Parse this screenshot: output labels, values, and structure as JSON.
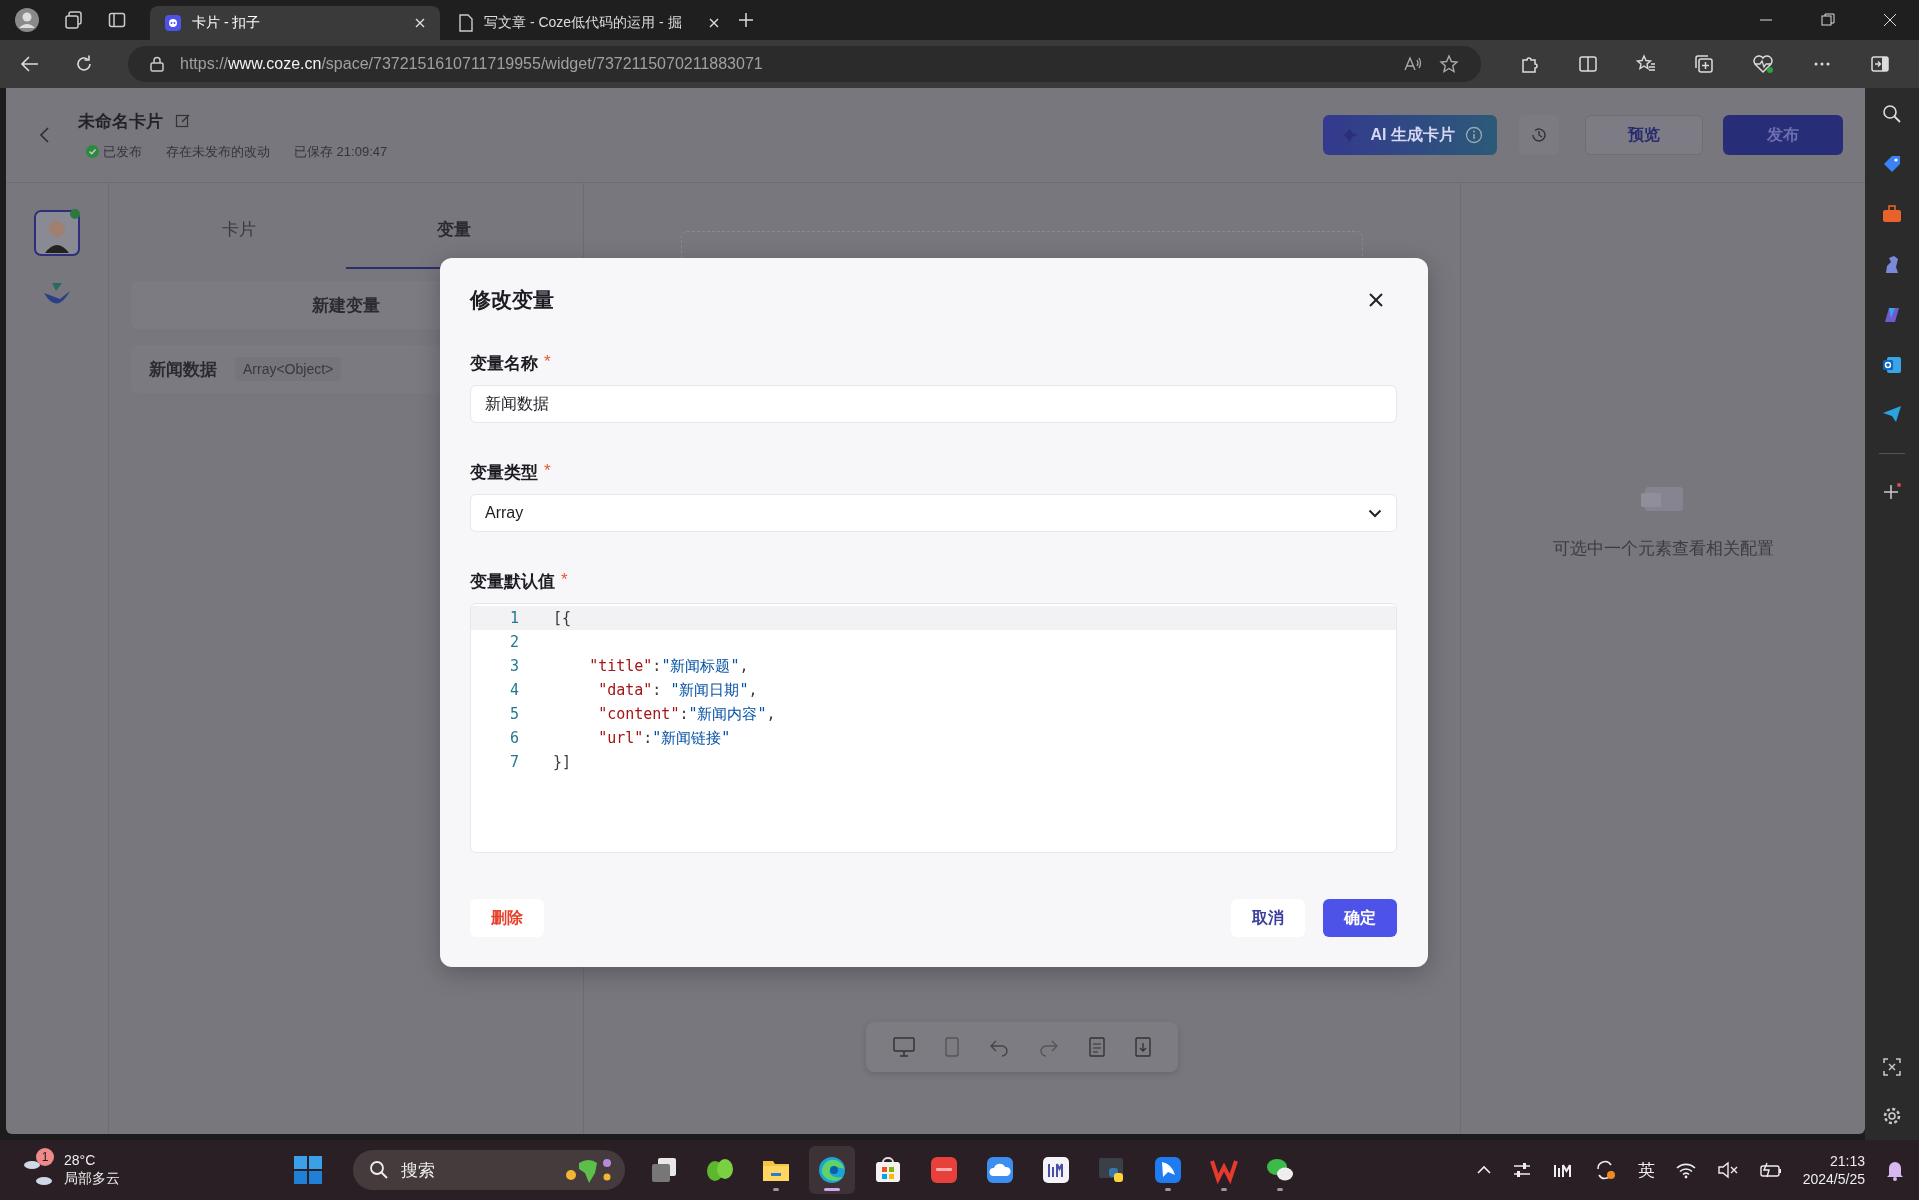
{
  "browser": {
    "tabs": [
      {
        "title": "卡片 - 扣子",
        "selected": true,
        "kind": "coze"
      },
      {
        "title": "写文章 - Coze低代码的运用 - 掘",
        "selected": false,
        "kind": "doc"
      }
    ],
    "url": "https://**www.coze.cn**/space/7372151610711719955/widget/7372115070211883071"
  },
  "header": {
    "title": "未命名卡片",
    "status": "已发布",
    "changes": "存在未发布的改动",
    "saved": "已保存 21:09:47",
    "ai_button": "AI 生成卡片",
    "preview_button": "预览",
    "publish_button": "发布"
  },
  "left_panel": {
    "tabs": [
      {
        "label": "卡片",
        "selected": false
      },
      {
        "label": "变量",
        "selected": true
      }
    ],
    "new_variable_button": "新建变量",
    "variables": [
      {
        "name": "新闻数据",
        "type": "Array<Object>"
      }
    ]
  },
  "right_panel": {
    "hint": "可选中一个元素查看相关配置"
  },
  "modal": {
    "title": "修改变量",
    "name_field": {
      "label": "变量名称",
      "required_mark": "*",
      "value": "新闻数据"
    },
    "type_field": {
      "label": "变量类型",
      "required_mark": "*",
      "value": "Array"
    },
    "default_field": {
      "label": "变量默认值",
      "required_mark": "*",
      "lines": [
        {
          "number": "1",
          "text": "[{"
        },
        {
          "number": "2"
        },
        {
          "number": "3",
          "text": "    \"title\":\"新闻标题\","
        },
        {
          "number": "4",
          "text": "     \"data\": \"新闻日期\","
        },
        {
          "number": "5",
          "text": "     \"content\":\"新闻内容\","
        },
        {
          "number": "6",
          "text": "     \"url\":\"新闻链接\""
        },
        {
          "number": "7",
          "text": "}]"
        }
      ]
    },
    "delete_button": "删除",
    "cancel_button": "取消",
    "confirm_button": "确定"
  },
  "taskbar": {
    "weather": {
      "badge": "1",
      "temperature": "28°C",
      "condition": "局部多云"
    },
    "search_placeholder": "搜索",
    "apps": [
      {
        "kind": "stack",
        "running": false,
        "selected": false
      },
      {
        "kind": "leaf",
        "running": false,
        "selected": false
      },
      {
        "kind": "folder",
        "running": true,
        "selected": false
      },
      {
        "kind": "browser",
        "running": true,
        "selected": true
      },
      {
        "kind": "store",
        "running": false,
        "selected": false
      },
      {
        "kind": "redtile",
        "running": false,
        "selected": false
      },
      {
        "kind": "cloud",
        "running": false,
        "selected": false
      },
      {
        "kind": "bars",
        "running": false,
        "selected": false
      },
      {
        "kind": "code",
        "running": false,
        "selected": false
      },
      {
        "kind": "bird",
        "running": true,
        "selected": false
      },
      {
        "kind": "zigzag",
        "running": true,
        "selected": false
      },
      {
        "kind": "chat",
        "running": true,
        "selected": false
      }
    ],
    "ime": "英",
    "time": "21:13",
    "date": "2024/5/25"
  }
}
